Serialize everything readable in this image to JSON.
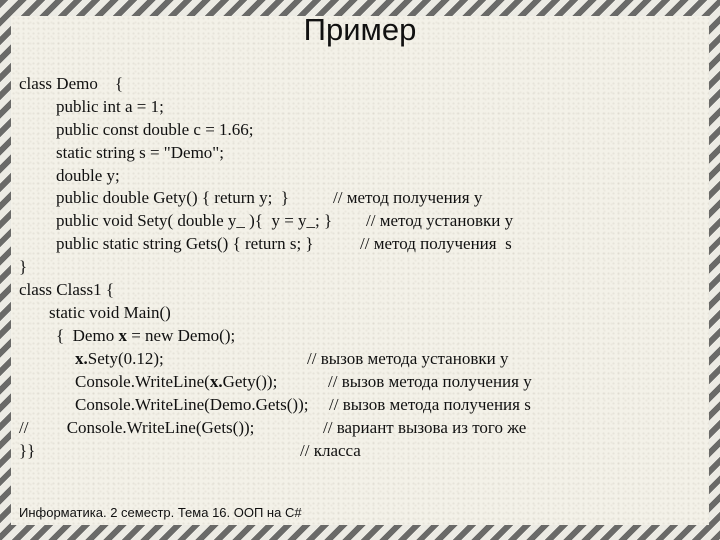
{
  "slide": {
    "title": "Пример",
    "footer": "Информатика. 2 семестр. Тема 16. ООП на C#"
  },
  "code_lines": [
    {
      "code": "class Demo    {",
      "comment": ""
    },
    {
      "code": "public int a = 1;",
      "comment": ""
    },
    {
      "code": "public const double c = 1.66;",
      "comment": ""
    },
    {
      "code": "static string s = \"Demo\";",
      "comment": ""
    },
    {
      "code": "double y;",
      "comment": ""
    },
    {
      "code": "public double Gety() { return y;  }",
      "comment": "// метод получения y"
    },
    {
      "code": "public void Sety( double y_ ){  y = y_; }",
      "comment": "// метод установки y"
    },
    {
      "code": "public static string Gets() { return s; }",
      "comment": "// метод получения  s"
    },
    {
      "code": "}",
      "comment": ""
    },
    {
      "code": "class Class1 {",
      "comment": ""
    },
    {
      "code": "static void Main()",
      "comment": ""
    },
    {
      "code_pre": "{  Demo ",
      "code_bold": "x",
      "code_post": " = new Demo();",
      "comment": ""
    },
    {
      "code_pre": "",
      "code_bold": "x.",
      "code_post": "Sety(0.12);",
      "comment": "// вызов метода установки y"
    },
    {
      "code_pre": "Console.WriteLine(",
      "code_bold": "x.",
      "code_post": "Gety());",
      "comment": "// вызов метода получения y"
    },
    {
      "code": "Console.WriteLine(Demo.Gets());",
      "comment": "// вызов метода получения s"
    },
    {
      "code": "//         Console.WriteLine(Gets());",
      "comment": "// вариант вызова из того же"
    },
    {
      "code": "}}",
      "comment": "// класса"
    }
  ]
}
